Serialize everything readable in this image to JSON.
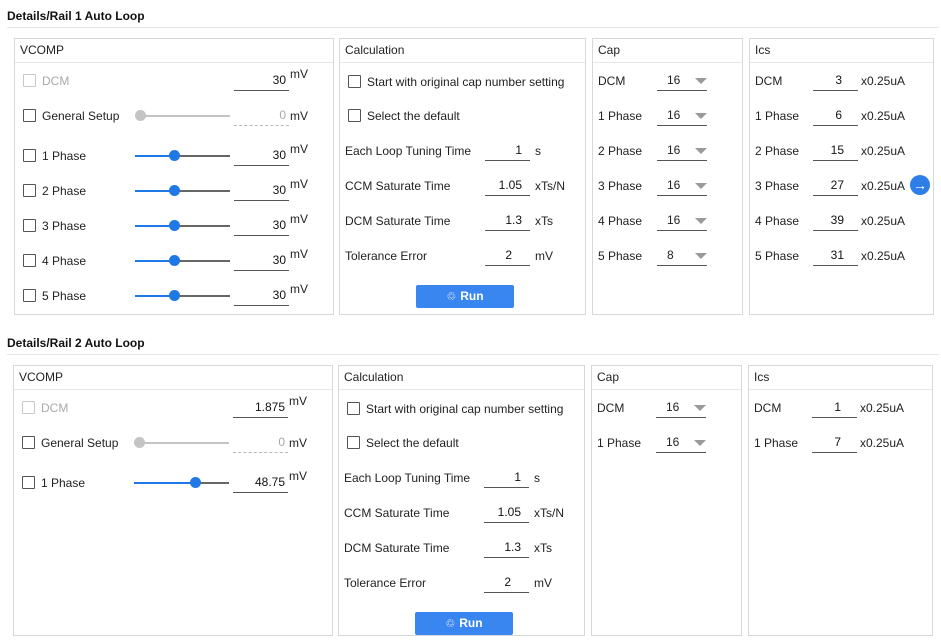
{
  "rail1": {
    "title": "Details/Rail 1 Auto Loop",
    "vcomp": {
      "title": "VCOMP",
      "unit": "mV",
      "dcm": {
        "label": "DCM",
        "value": "30"
      },
      "general": {
        "label": "General Setup",
        "value": "0"
      },
      "phases": [
        {
          "label": "1 Phase",
          "value": "30",
          "level": 0.4
        },
        {
          "label": "2 Phase",
          "value": "30",
          "level": 0.4
        },
        {
          "label": "3 Phase",
          "value": "30",
          "level": 0.4
        },
        {
          "label": "4 Phase",
          "value": "30",
          "level": 0.4
        },
        {
          "label": "5 Phase",
          "value": "30",
          "level": 0.4
        }
      ]
    },
    "calc": {
      "title": "Calculation",
      "start_original": "Start with original cap number setting",
      "select_default": "Select the default",
      "fields": [
        {
          "label": "Each Loop Tuning Time",
          "value": "1",
          "unit": "s"
        },
        {
          "label": "CCM Saturate Time",
          "value": "1.05",
          "unit": "xTs/N"
        },
        {
          "label": "DCM Saturate Time",
          "value": "1.3",
          "unit": "xTs"
        },
        {
          "label": "Tolerance Error",
          "value": "2",
          "unit": "mV"
        }
      ],
      "run_label": "Run"
    },
    "cap": {
      "title": "Cap",
      "rows": [
        {
          "label": "DCM",
          "value": "16"
        },
        {
          "label": "1 Phase",
          "value": "16"
        },
        {
          "label": "2 Phase",
          "value": "16"
        },
        {
          "label": "3 Phase",
          "value": "16"
        },
        {
          "label": "4 Phase",
          "value": "16"
        },
        {
          "label": "5 Phase",
          "value": "8"
        }
      ]
    },
    "ics": {
      "title": "Ics",
      "unit": "x0.25uA",
      "rows": [
        {
          "label": "DCM",
          "value": "3"
        },
        {
          "label": "1 Phase",
          "value": "6"
        },
        {
          "label": "2 Phase",
          "value": "15"
        },
        {
          "label": "3 Phase",
          "value": "27"
        },
        {
          "label": "4 Phase",
          "value": "39"
        },
        {
          "label": "5 Phase",
          "value": "31"
        }
      ]
    }
  },
  "rail2": {
    "title": "Details/Rail 2 Auto Loop",
    "vcomp": {
      "title": "VCOMP",
      "unit": "mV",
      "dcm": {
        "label": "DCM",
        "value": "1.875"
      },
      "general": {
        "label": "General Setup",
        "value": "0"
      },
      "phases": [
        {
          "label": "1 Phase",
          "value": "48.75",
          "level": 0.65
        }
      ]
    },
    "calc": {
      "title": "Calculation",
      "start_original": "Start with original cap number setting",
      "select_default": "Select the default",
      "fields": [
        {
          "label": "Each Loop Tuning Time",
          "value": "1",
          "unit": "s"
        },
        {
          "label": "CCM Saturate Time",
          "value": "1.05",
          "unit": "xTs/N"
        },
        {
          "label": "DCM Saturate Time",
          "value": "1.3",
          "unit": "xTs"
        },
        {
          "label": "Tolerance Error",
          "value": "2",
          "unit": "mV"
        }
      ],
      "run_label": "Run"
    },
    "cap": {
      "title": "Cap",
      "rows": [
        {
          "label": "DCM",
          "value": "16"
        },
        {
          "label": "1 Phase",
          "value": "16"
        }
      ]
    },
    "ics": {
      "title": "Ics",
      "unit": "x0.25uA",
      "rows": [
        {
          "label": "DCM",
          "value": "1"
        },
        {
          "label": "1 Phase",
          "value": "7"
        }
      ]
    }
  },
  "colors": {
    "accent": "#1e78e6",
    "button": "#3a86f0"
  },
  "icons": {
    "run": "recycle-icon",
    "next": "arrow-right-icon"
  }
}
